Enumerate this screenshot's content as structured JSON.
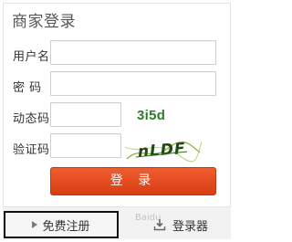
{
  "login_panel": {
    "title": "商家登录",
    "fields": {
      "username_label": "用户名",
      "password_label": "密 码",
      "dynamic_code_label": "动态码",
      "dynamic_code_value": "3i5d",
      "captcha_label": "验证码",
      "captcha_text": "nLDF"
    },
    "login_button": "登 录"
  },
  "footer": {
    "register_label": "免费注册",
    "download_label": "登录器"
  },
  "watermark": "Baidu"
}
